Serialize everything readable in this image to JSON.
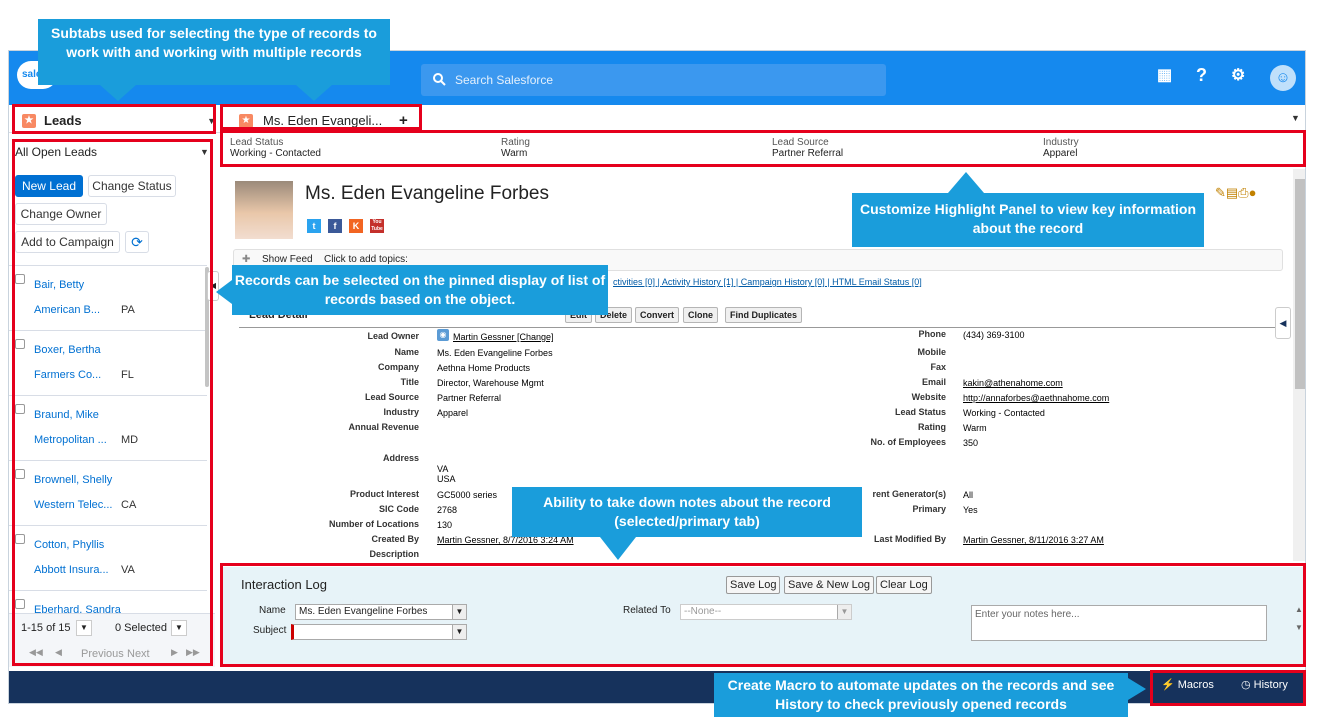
{
  "topbar": {
    "logo": "sale",
    "search_placeholder": "Search Salesforce"
  },
  "workspace": {
    "leads_tab": "Leads",
    "record_subtab": "Ms. Eden Evangeli...",
    "add_tab": "+"
  },
  "highlight": {
    "fields": [
      {
        "label": "Lead Status",
        "value": "Working - Contacted"
      },
      {
        "label": "Rating",
        "value": "Warm"
      },
      {
        "label": "Lead Source",
        "value": "Partner Referral"
      },
      {
        "label": "Industry",
        "value": "Apparel"
      }
    ]
  },
  "sidebar": {
    "list_view": "All Open Leads",
    "new_lead": "New Lead",
    "change_status": "Change Status",
    "change_owner": "Change Owner",
    "add_campaign": "Add to Campaign",
    "records": [
      {
        "name": "Bair, Betty",
        "company": "American B...",
        "state": "PA"
      },
      {
        "name": "Boxer, Bertha",
        "company": "Farmers Co...",
        "state": "FL"
      },
      {
        "name": "Braund, Mike",
        "company": "Metropolitan ...",
        "state": "MD"
      },
      {
        "name": "Brownell, Shelly",
        "company": "Western Telec...",
        "state": "CA"
      },
      {
        "name": "Cotton, Phyllis",
        "company": "Abbott Insura...",
        "state": "VA"
      },
      {
        "name": "Eberhard, Sandra",
        "company": "",
        "state": ""
      }
    ],
    "range": "1-15 of 15",
    "selected": "0 Selected",
    "previous": "Previous",
    "next": "Next"
  },
  "record": {
    "name": "Ms. Eden Evangeline Forbes",
    "social": [
      "t",
      "f",
      "K",
      "You Tube"
    ],
    "show_feed": "Show Feed",
    "topics": "Click to add topics:",
    "related_links": "ctivities [0]  |  Activity History [1]  |  Campaign History [0]  |  HTML Email Status [0]",
    "section": "Lead Detail",
    "buttons": {
      "edit": "Edit",
      "delete": "Delete",
      "convert": "Convert",
      "clone": "Clone",
      "find_dup": "Find Duplicates"
    },
    "left_fields": [
      {
        "label": "Lead Owner",
        "value": "Martin Gessner [Change]"
      },
      {
        "label": "Name",
        "value": "Ms. Eden Evangeline Forbes"
      },
      {
        "label": "Company",
        "value": "Aethna Home Products"
      },
      {
        "label": "Title",
        "value": "Director, Warehouse Mgmt"
      },
      {
        "label": "Lead Source",
        "value": "Partner Referral"
      },
      {
        "label": "Industry",
        "value": "Apparel"
      },
      {
        "label": "Annual Revenue",
        "value": ""
      }
    ],
    "right_fields": [
      {
        "label": "Phone",
        "value": "(434) 369-3100"
      },
      {
        "label": "Mobile",
        "value": ""
      },
      {
        "label": "Fax",
        "value": ""
      },
      {
        "label": "Email",
        "value": "kakin@athenahome.com"
      },
      {
        "label": "Website",
        "value": "http://annaforbes@aethnahome.com"
      },
      {
        "label": "Lead Status",
        "value": "Working - Contacted"
      },
      {
        "label": "Rating",
        "value": "Warm"
      },
      {
        "label": "No. of Employees",
        "value": "350"
      }
    ],
    "address_label": "Address",
    "address_lines": [
      "VA",
      "USA"
    ],
    "lower_left": [
      {
        "label": "Product Interest",
        "value": "GC5000 series"
      },
      {
        "label": "SIC Code",
        "value": "2768"
      },
      {
        "label": "Number of Locations",
        "value": "130"
      },
      {
        "label": "Created By",
        "value": "Martin Gessner, 8/7/2016 3:24 AM"
      },
      {
        "label": "Description",
        "value": ""
      }
    ],
    "lower_right": [
      {
        "label": "rent Generator(s)",
        "value": "All"
      },
      {
        "label": "Primary",
        "value": "Yes"
      },
      {
        "label": "Last Modified By",
        "value": "Martin Gessner, 8/11/2016 3:27 AM"
      }
    ]
  },
  "interaction_log": {
    "title": "Interaction Log",
    "save": "Save Log",
    "save_new": "Save & New Log",
    "clear": "Clear Log",
    "name_label": "Name",
    "name_value": "Ms. Eden Evangeline Forbes",
    "related_label": "Related To",
    "related_value": "--None--",
    "subject_label": "Subject",
    "notes_placeholder": "Enter your notes here..."
  },
  "footer": {
    "macros": "Macros",
    "history": "History"
  },
  "callouts": {
    "subtabs": "Subtabs used for selecting the type of records to work with and working with multiple records",
    "highlight": "Customize Highlight Panel to view key information about the record",
    "records": "Records can be selected on the pinned display of list of records based on the object.",
    "notes": "Ability to take down notes about the record (selected/primary tab)",
    "macro": "Create Macro to automate updates on the records and see History to check previously opened records"
  },
  "colors": {
    "brand": "#1589ee",
    "callout": "#1a9ddb",
    "highlight_box": "#e5001c",
    "footer": "#16325c"
  }
}
